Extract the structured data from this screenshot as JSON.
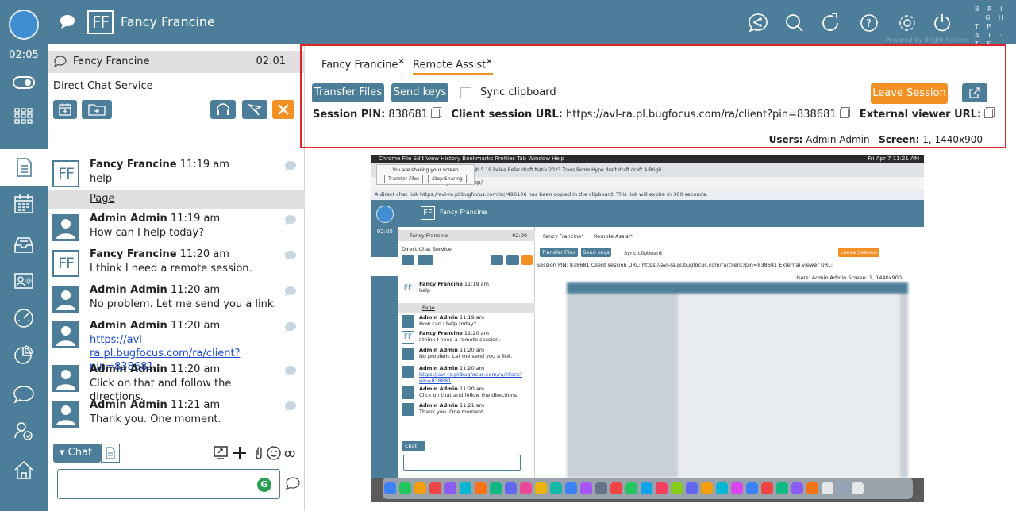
{
  "rail": {
    "timer": "02:05"
  },
  "header": {
    "avatar_initials": "FF",
    "customer_name": "Fancy Francine",
    "brand": "B R I · G H T P A T · T E R N",
    "powered_by": "Powered by Bright Pattern"
  },
  "conversation": {
    "head_name": "Fancy Francine",
    "head_time": "02:01",
    "service": "Direct Chat Service",
    "page_label": "Page",
    "messages": [
      {
        "author": "Fancy Francine",
        "time": "11:19 am",
        "text": "help",
        "avatar": "FF"
      },
      {
        "author": "Admin Admin",
        "time": "11:19 am",
        "text": "How can I help today?",
        "avatar": "pic"
      },
      {
        "author": "Fancy Francine",
        "time": "11:20 am",
        "text": "I think I need a remote session.",
        "avatar": "FF"
      },
      {
        "author": "Admin Admin",
        "time": "11:20 am",
        "text": "No problem. Let me send you a link.",
        "avatar": "pic"
      },
      {
        "author": "Admin Admin",
        "time": "11:20 am",
        "link": "https://avl-ra.pl.bugfocus.com/ra/client?pin=838681",
        "avatar": "pic"
      },
      {
        "author": "Admin Admin",
        "time": "11:20 am",
        "text": "Click on that and follow the directions.",
        "avatar": "pic"
      },
      {
        "author": "Admin Admin",
        "time": "11:21 am",
        "text": "Thank you. One moment.",
        "avatar": "pic"
      }
    ],
    "chat_tab_label": "Chat",
    "composer_value": "",
    "g_badge": "G"
  },
  "remote_assist": {
    "tabs": [
      {
        "label": "Fancy Francine",
        "close": "×"
      },
      {
        "label": "Remote Assist",
        "close": "×"
      }
    ],
    "transfer_files": "Transfer Files",
    "send_keys": "Send keys",
    "sync_clipboard": "Sync clipboard",
    "leave_session": "Leave Session",
    "session_pin_label": "Session PIN:",
    "session_pin": "838681",
    "client_url_label": "Client session URL:",
    "client_url": "https://avl-ra.pl.bugfocus.com/ra/client?pin=838681",
    "external_url_label": "External viewer URL:",
    "users_label": "Users:",
    "users": "Admin Admin",
    "screen_label": "Screen:",
    "screen": "1, 1440x900"
  },
  "shared_screen": {
    "menu_bar": "Chrome   File   Edit   View   History   Bookmarks   Profiles   Tab   Window   Help",
    "clock": "Fri Apr 7  11:21 AM",
    "sharing_notice": "You are sharing your screen",
    "share_transfer": "Transfer Files",
    "share_stop": "Stop Sharing",
    "tabs_strip": "Brigh   5.19   Relea   Refer   draft   Nativ   2023   Trans   Remo   Hype   draft   draft   draft   A   Brigh",
    "url": "com/agentdesktop/",
    "notice": "A direct chat link https://avl-ra.pl.bugfocus.com/dc/496106 has been copied in the clipboard. This link will expire in 300 seconds.",
    "inner_name": "Fancy Francine",
    "inner_timer": "02:05",
    "inner_head_time": "02:00",
    "inner_service": "Direct Chat Service",
    "inner_page": "Page",
    "inner_messages": [
      {
        "author": "Fancy Francine",
        "time": "11:19 am",
        "text": "help",
        "av": "FF"
      },
      {
        "author": "Admin Admin",
        "time": "11:19 am",
        "text": "How can I help today?",
        "av": "pic"
      },
      {
        "author": "Fancy Francine",
        "time": "11:20 am",
        "text": "I think I need a remote session.",
        "av": "FF"
      },
      {
        "author": "Admin Admin",
        "time": "11:20 am",
        "text": "No problem. Let me send you a link.",
        "av": "pic"
      },
      {
        "author": "Admin Admin",
        "time": "11:20 am",
        "text": "https://avl-ra.pl.bugfocus.com/ra/client?pin=838681",
        "av": "pic"
      },
      {
        "author": "Admin Admin",
        "time": "11:20 am",
        "text": "Click on that and follow the directions.",
        "av": "pic"
      },
      {
        "author": "Admin Admin",
        "time": "11:21 am",
        "text": "Thank you. One moment.",
        "av": "pic"
      }
    ],
    "inner_chat": "Chat",
    "inner_tab1": "Fancy Francine",
    "inner_tab2": "Remote Assist",
    "inner_transfer": "Transfer Files",
    "inner_sendkeys": "Send keys",
    "inner_sync": "Sync clipboard",
    "inner_leave": "Leave Session",
    "inner_info": "Session PIN: 838681   Client session URL: https://avl-ra.pl.bugfocus.com/ra/client?pin=838681   External viewer URL:",
    "inner_users": "Users: Admin Admin  Screen: 1, 1440x900"
  },
  "colors": {
    "brand": "#4c7d99",
    "accent": "#f39024",
    "highlight_frame": "#e2232a",
    "link": "#1f4fcf"
  }
}
